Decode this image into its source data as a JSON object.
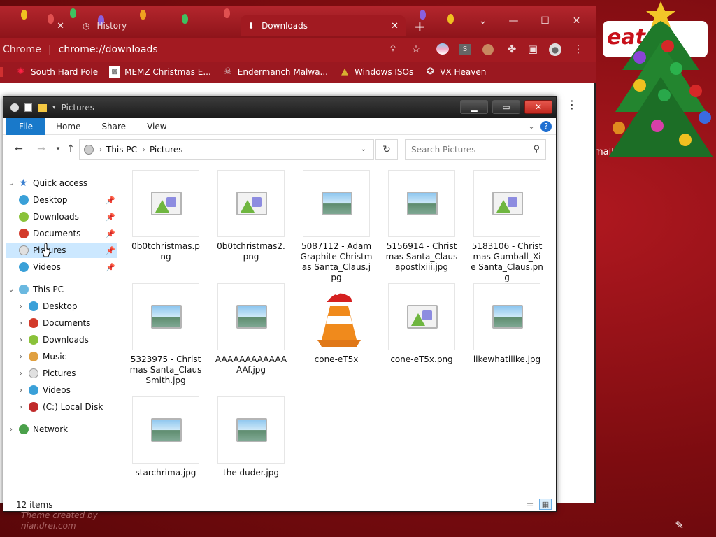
{
  "chrome": {
    "tabs": [
      {
        "label": "",
        "icon": "partial-tab"
      },
      {
        "label": "History",
        "icon": "history-icon"
      },
      {
        "label": "Downloads",
        "icon": "download-icon"
      }
    ],
    "omnibox": {
      "brand": "Chrome",
      "separator": "|",
      "url_prefix": "chrome://",
      "url_path": "downloads"
    },
    "bookmarks": [
      {
        "label": "South Hard Pole",
        "icon": "snowflake-icon"
      },
      {
        "label": "MEMZ Christmas E...",
        "icon": "image-icon"
      },
      {
        "label": "Endermanch Malwa...",
        "icon": "skull-icon"
      },
      {
        "label": "Windows ISOs",
        "icon": "tree-icon"
      },
      {
        "label": "VX Heaven",
        "icon": "badge-icon"
      }
    ],
    "background_page": {
      "heading": "eat",
      "nav": "mail · Images"
    }
  },
  "explorer": {
    "title": "Pictures",
    "ribbon": {
      "file": "File",
      "home": "Home",
      "share": "Share",
      "view": "View"
    },
    "address": {
      "root": "This PC",
      "current": "Pictures"
    },
    "search_placeholder": "Search Pictures",
    "sidebar": {
      "quick_access": "Quick access",
      "quick_items": [
        "Desktop",
        "Downloads",
        "Documents",
        "Pictures",
        "Videos"
      ],
      "this_pc": "This PC",
      "pc_items": [
        "Desktop",
        "Documents",
        "Downloads",
        "Music",
        "Pictures",
        "Videos",
        "(C:) Local Disk"
      ],
      "network": "Network"
    },
    "files": [
      {
        "name": "0b0tchristmas.png",
        "kind": "shapes"
      },
      {
        "name": "0b0tchristmas2.png",
        "kind": "shapes"
      },
      {
        "name": "5087112 - AdamGraphite Christmas Santa_Claus.jpg",
        "kind": "photo"
      },
      {
        "name": "5156914 - Christmas Santa_Claus apostlxiii.jpg",
        "kind": "photo"
      },
      {
        "name": "5183106 - Christmas Gumball_Xie Santa_Claus.png",
        "kind": "shapes"
      },
      {
        "name": "5323975 - Christmas Santa_Claus Smith.jpg",
        "kind": "photo"
      },
      {
        "name": "AAAAAAAAAAAAAAf.jpg",
        "kind": "photo"
      },
      {
        "name": "cone-eT5x",
        "kind": "cone"
      },
      {
        "name": "cone-eT5x.png",
        "kind": "shapes"
      },
      {
        "name": "likewhatilike.jpg",
        "kind": "photo"
      },
      {
        "name": "starchrima.jpg",
        "kind": "photo"
      },
      {
        "name": "the duder.jpg",
        "kind": "photo"
      }
    ],
    "status": "12 items"
  },
  "desktop": {
    "credit_line1": "Theme created by",
    "credit_line2": "niandrei.com"
  }
}
